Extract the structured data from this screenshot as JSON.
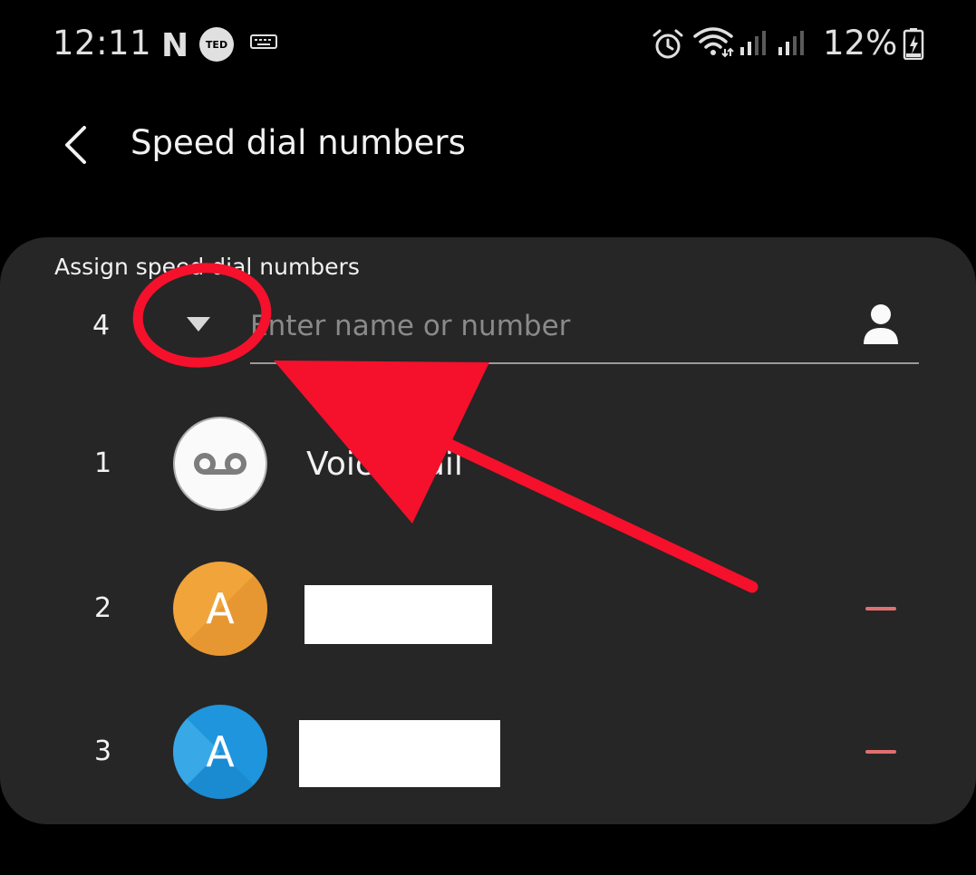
{
  "status_bar": {
    "time": "12:11",
    "netflix_glyph": "N",
    "ted_glyph": "TED",
    "battery_percent": "12%",
    "icons": [
      "netflix-icon",
      "ted-icon",
      "keyboard-icon",
      "alarm-icon",
      "wifi-icon",
      "signal-icon",
      "signal-icon",
      "battery-charging-icon"
    ]
  },
  "header": {
    "title": "Speed dial numbers",
    "back_icon": "chevron-left-icon"
  },
  "assign": {
    "section_label": "Assign speed dial numbers",
    "selected_slot": "4",
    "placeholder": "Enter name or number",
    "dropdown_icon": "triangle-down-icon",
    "contact_icon": "person-icon"
  },
  "list": [
    {
      "slot": "1",
      "name": "Voicemail",
      "avatar": "voicemail-icon"
    },
    {
      "slot": "2",
      "avatar_letter": "A",
      "avatar_color": "#f0a43a",
      "remove_icon": "minus-icon"
    },
    {
      "slot": "3",
      "avatar_letter": "A",
      "avatar_color": "#1e95dd",
      "remove_icon": "minus-icon"
    }
  ],
  "colors": {
    "background": "#000000",
    "card": "#262626",
    "remove_accent": "#e07070",
    "annotation_red": "#f5102c"
  }
}
